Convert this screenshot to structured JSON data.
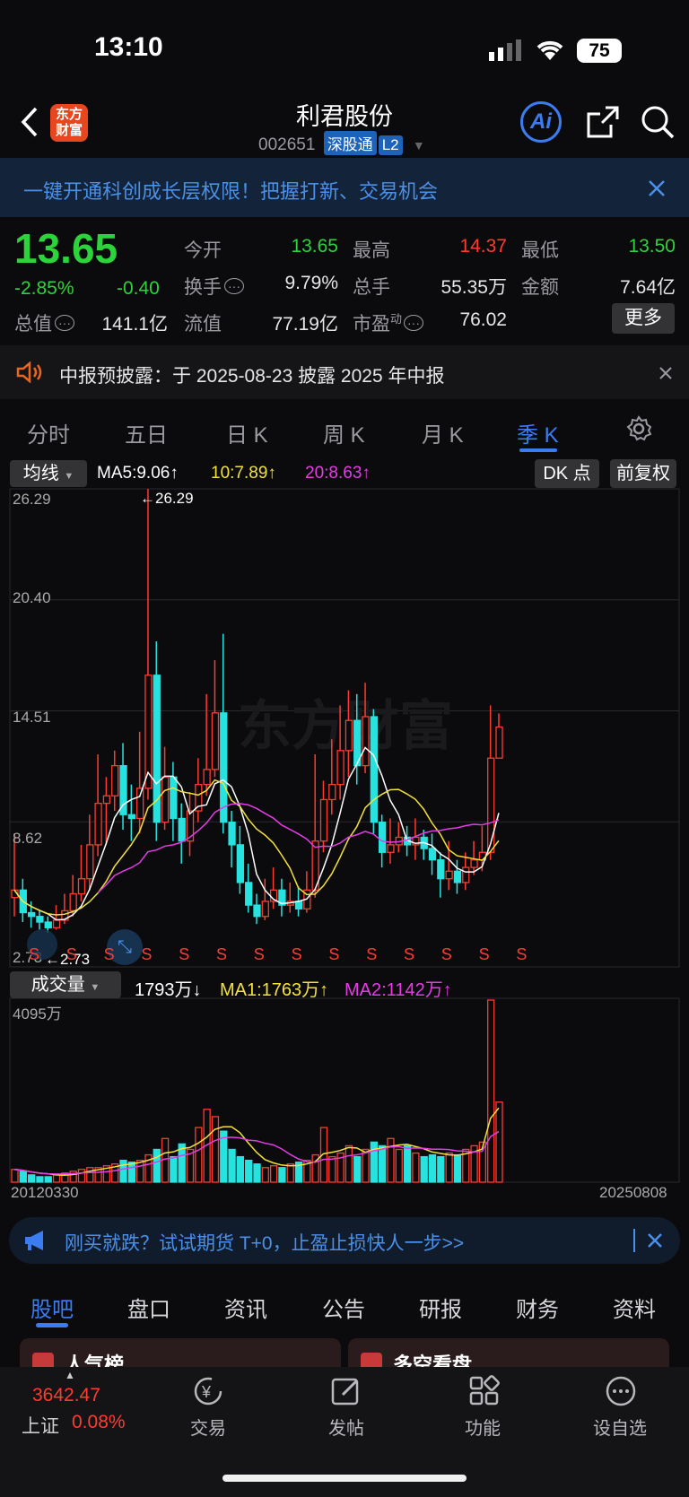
{
  "status_bar": {
    "time": "13:10",
    "battery": "75"
  },
  "header": {
    "title": "利君股份",
    "code": "002651",
    "tag_connect": "深股通",
    "tag_level": "L2",
    "logo_line1": "东方",
    "logo_line2": "财富",
    "ai_label": "Ai"
  },
  "promo": {
    "text": "一键开通科创成长层权限！把握打新、交易机会"
  },
  "quote": {
    "price": "13.65",
    "change_pct": "-2.85%",
    "change": "-0.40",
    "open_label": "今开",
    "open": "13.65",
    "high_label": "最高",
    "high": "14.37",
    "low_label": "最低",
    "low": "13.50",
    "turnover_label": "换手",
    "turnover": "9.79%",
    "volume_label": "总手",
    "volume": "55.35万",
    "amount_label": "金额",
    "amount": "7.64亿",
    "mktcap_label": "总值",
    "mktcap": "141.1亿",
    "float_label": "流值",
    "float_cap": "77.19亿",
    "pe_label": "市盈",
    "pe_sup": "动",
    "pe": "76.02",
    "more": "更多"
  },
  "notice": {
    "text": "中报预披露：于 2025-08-23 披露 2025 年中报"
  },
  "period_tabs": [
    "分时",
    "五日",
    "日 K",
    "周 K",
    "月 K",
    "季 K"
  ],
  "active_period": "季 K",
  "kline": {
    "ma_selector": "均线",
    "ma5": "MA5:9.06",
    "ma10": "10:7.89",
    "ma20": "20:8.63",
    "dk_button": "DK 点",
    "adjust_button": "前复权",
    "y_labels": [
      "26.29",
      "20.40",
      "14.51",
      "8.62",
      "2.73"
    ],
    "max_marker": "26.29",
    "min_marker": "2.73",
    "signal": "S"
  },
  "volume_panel": {
    "selector": "成交量",
    "current": "1793万",
    "ma1": "MA1:1763万",
    "ma2": "MA2:1142万",
    "y_max": "4095万",
    "start_date": "20120330",
    "end_date": "20250808"
  },
  "colors": {
    "up": "#ff3b30",
    "down": "#27e3e0",
    "ma5": "#ffffff",
    "ma10": "#f3e23a",
    "ma20": "#e53ce4",
    "brand": "#e8461e",
    "accent": "#3b7df0"
  },
  "chart_data": {
    "type": "candlestick",
    "x": [
      "2012Q1",
      "2025Q3"
    ],
    "y_range": [
      2.73,
      26.29
    ],
    "highest": 26.29,
    "lowest": 2.73,
    "volume_max": "4095万",
    "ma": {
      "MA5": 9.06,
      "MA10": 7.89,
      "MA20": 8.63
    },
    "volume_ma": {
      "MA1": "1763万",
      "MA2": "1142万"
    }
  },
  "bottom_banner": {
    "text": "刚买就跌？试试期货 T+0，止盈止损快人一步>>"
  },
  "sub_tabs": [
    "股吧",
    "盘口",
    "资讯",
    "公告",
    "研报",
    "财务",
    "资料"
  ],
  "cards": {
    "left": "人气榜",
    "right": "多空看盘"
  },
  "index": {
    "value": "3642.47",
    "name": "上证",
    "change": "0.08%"
  },
  "tab_bar": [
    "交易",
    "发帖",
    "功能",
    "设自选"
  ],
  "watermark": "东方财富"
}
